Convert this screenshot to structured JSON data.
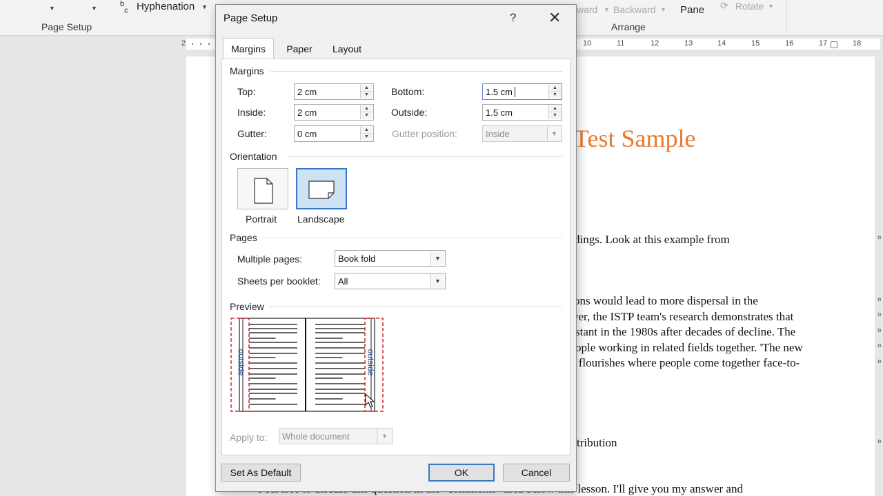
{
  "ribbon": {
    "hyphenation_label": "Hyphenation",
    "page_setup_group": "Page Setup",
    "arrange_group": "Arrange",
    "pane_label": "Pane",
    "forward_label": "ward",
    "backward_label": "Backward",
    "rotate_label": "Rotate"
  },
  "ruler": {
    "left_number": "2",
    "right_numbers": [
      "10",
      "11",
      "12",
      "13",
      "14",
      "15",
      "16",
      "17",
      "18"
    ]
  },
  "document": {
    "title": "Test Sample",
    "lines": [
      "dings. Look at this example from",
      "ons would lead to more dispersal in the",
      "ver, the ISTP team's research demonstrates that",
      "stant in the 1980s after decades of decline. The",
      "ople working in related fields together. 'The new",
      "y flourishes where people come together face-to-",
      "tribution",
      "Feel free to discuss this question in the \"comments\" area below this lesson. I'll give you my answer and"
    ]
  },
  "dialog": {
    "title": "Page Setup",
    "help": "?",
    "close": "✕",
    "tabs": [
      {
        "label": "Margins",
        "active": true
      },
      {
        "label": "Paper",
        "active": false
      },
      {
        "label": "Layout",
        "active": false
      }
    ],
    "margins": {
      "section": "Margins",
      "top_label": "Top:",
      "top_value": "2 cm",
      "bottom_label": "Bottom:",
      "bottom_value": "1.5 cm",
      "inside_label": "Inside:",
      "inside_value": "2 cm",
      "outside_label": "Outside:",
      "outside_value": "1.5 cm",
      "gutter_label": "Gutter:",
      "gutter_value": "0 cm",
      "gutter_position_label": "Gutter position:",
      "gutter_position_value": "Inside"
    },
    "orientation": {
      "section": "Orientation",
      "portrait_label": "Portrait",
      "landscape_label": "Landscape",
      "selected": "Landscape"
    },
    "pages": {
      "section": "Pages",
      "multiple_pages_label": "Multiple pages:",
      "multiple_pages_value": "Book fold",
      "sheets_label": "Sheets per booklet:",
      "sheets_value": "All"
    },
    "preview": {
      "section": "Preview",
      "outside_label_left": "outside",
      "outside_label_right": "outside"
    },
    "apply": {
      "label": "Apply to:",
      "value": "Whole document"
    },
    "buttons": {
      "set_default": "Set As Default",
      "ok": "OK",
      "cancel": "Cancel"
    }
  },
  "colors": {
    "title_orange": "#e8792e",
    "accent_blue": "#3a77c4",
    "preview_dash_red": "#d9262e",
    "preview_label_blue": "#2a4d9a"
  },
  "icons": [
    "caret-down-icon",
    "hyphenation-icon",
    "rotate-icon",
    "portrait-page-icon",
    "landscape-page-icon",
    "help-icon",
    "close-icon",
    "spin-up-icon",
    "spin-down-icon",
    "dropdown-arrow-icon",
    "mouse-cursor-icon"
  ]
}
